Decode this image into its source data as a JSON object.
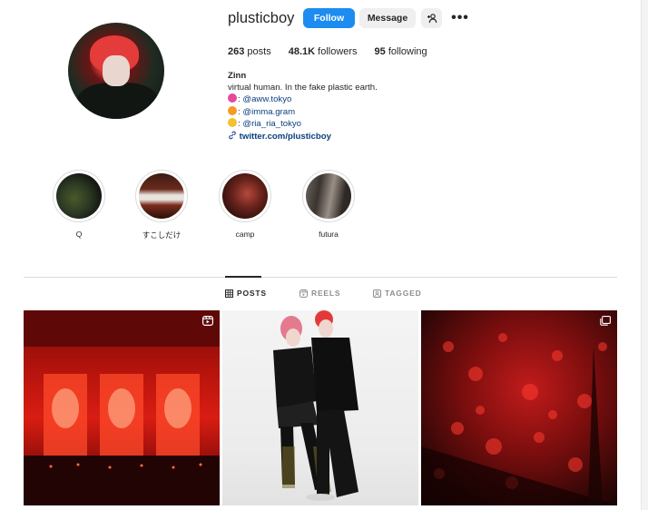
{
  "profile": {
    "username": "plusticboy",
    "follow_label": "Follow",
    "message_label": "Message",
    "more_label": "•••"
  },
  "stats": [
    {
      "value": "263",
      "label": "posts"
    },
    {
      "value": "48.1K",
      "label": "followers"
    },
    {
      "value": "95",
      "label": "following"
    }
  ],
  "bio": {
    "name": "Zinn",
    "line1": "virtual human. In the fake plastic earth.",
    "links": [
      {
        "emoji_color": "#e54b9b",
        "handle": "@aww.tokyo"
      },
      {
        "emoji_color": "#f59b25",
        "handle": "@imma.gram"
      },
      {
        "emoji_color": "#f2c230",
        "handle": "@ria_ria_tokyo"
      }
    ],
    "website": "twitter.com/plusticboy",
    "separator": ": "
  },
  "highlights": [
    {
      "label": "Q"
    },
    {
      "label": "すこしだけ"
    },
    {
      "label": "camp"
    },
    {
      "label": "futura"
    }
  ],
  "tabs": [
    {
      "label": "POSTS",
      "active": true
    },
    {
      "label": "REELS",
      "active": false
    },
    {
      "label": "TAGGED",
      "active": false
    }
  ],
  "colors": {
    "accent": "#1c8cf0",
    "link": "#0a3f7e"
  }
}
